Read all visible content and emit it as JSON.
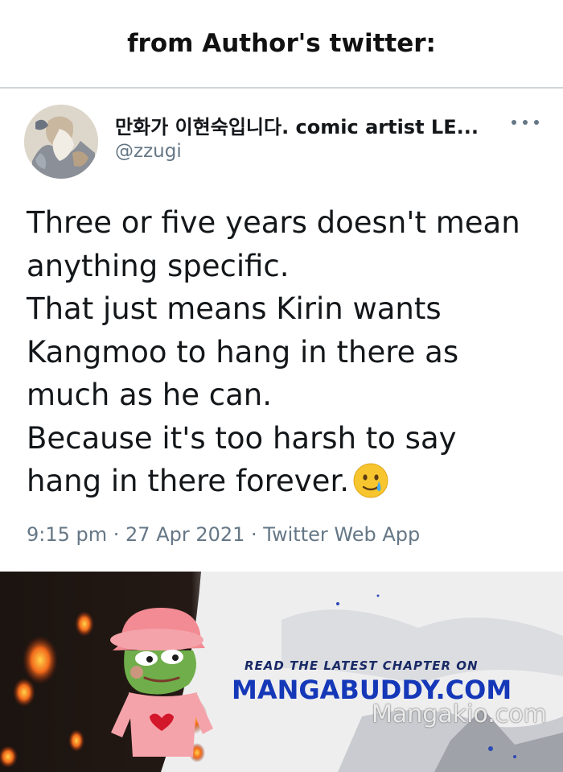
{
  "header": {
    "title": "from Author's twitter:"
  },
  "tweet": {
    "display_name": "만화가 이현숙입니다. comic artist LE...",
    "handle": "@zzugi",
    "lines": [
      "Three or five years doesn't mean",
      "anything specific.",
      "That just means Kirin wants",
      "Kangmoo to hang in there as",
      "much as he can.",
      "Because it's too harsh to say",
      "hang in there forever."
    ],
    "emoji": "smiling-face-with-tear-icon",
    "meta": "9:15 pm · 27 Apr 2021 · Twitter Web App"
  },
  "banner": {
    "cta": "READ THE LATEST CHAPTER ON",
    "site": "MANGABUDDY.COM",
    "watermark": "Mangakio.com"
  },
  "colors": {
    "text_primary": "#14171a",
    "text_secondary": "#657786",
    "divider": "#cfd4d8",
    "banner_blue": "#1538b8"
  }
}
